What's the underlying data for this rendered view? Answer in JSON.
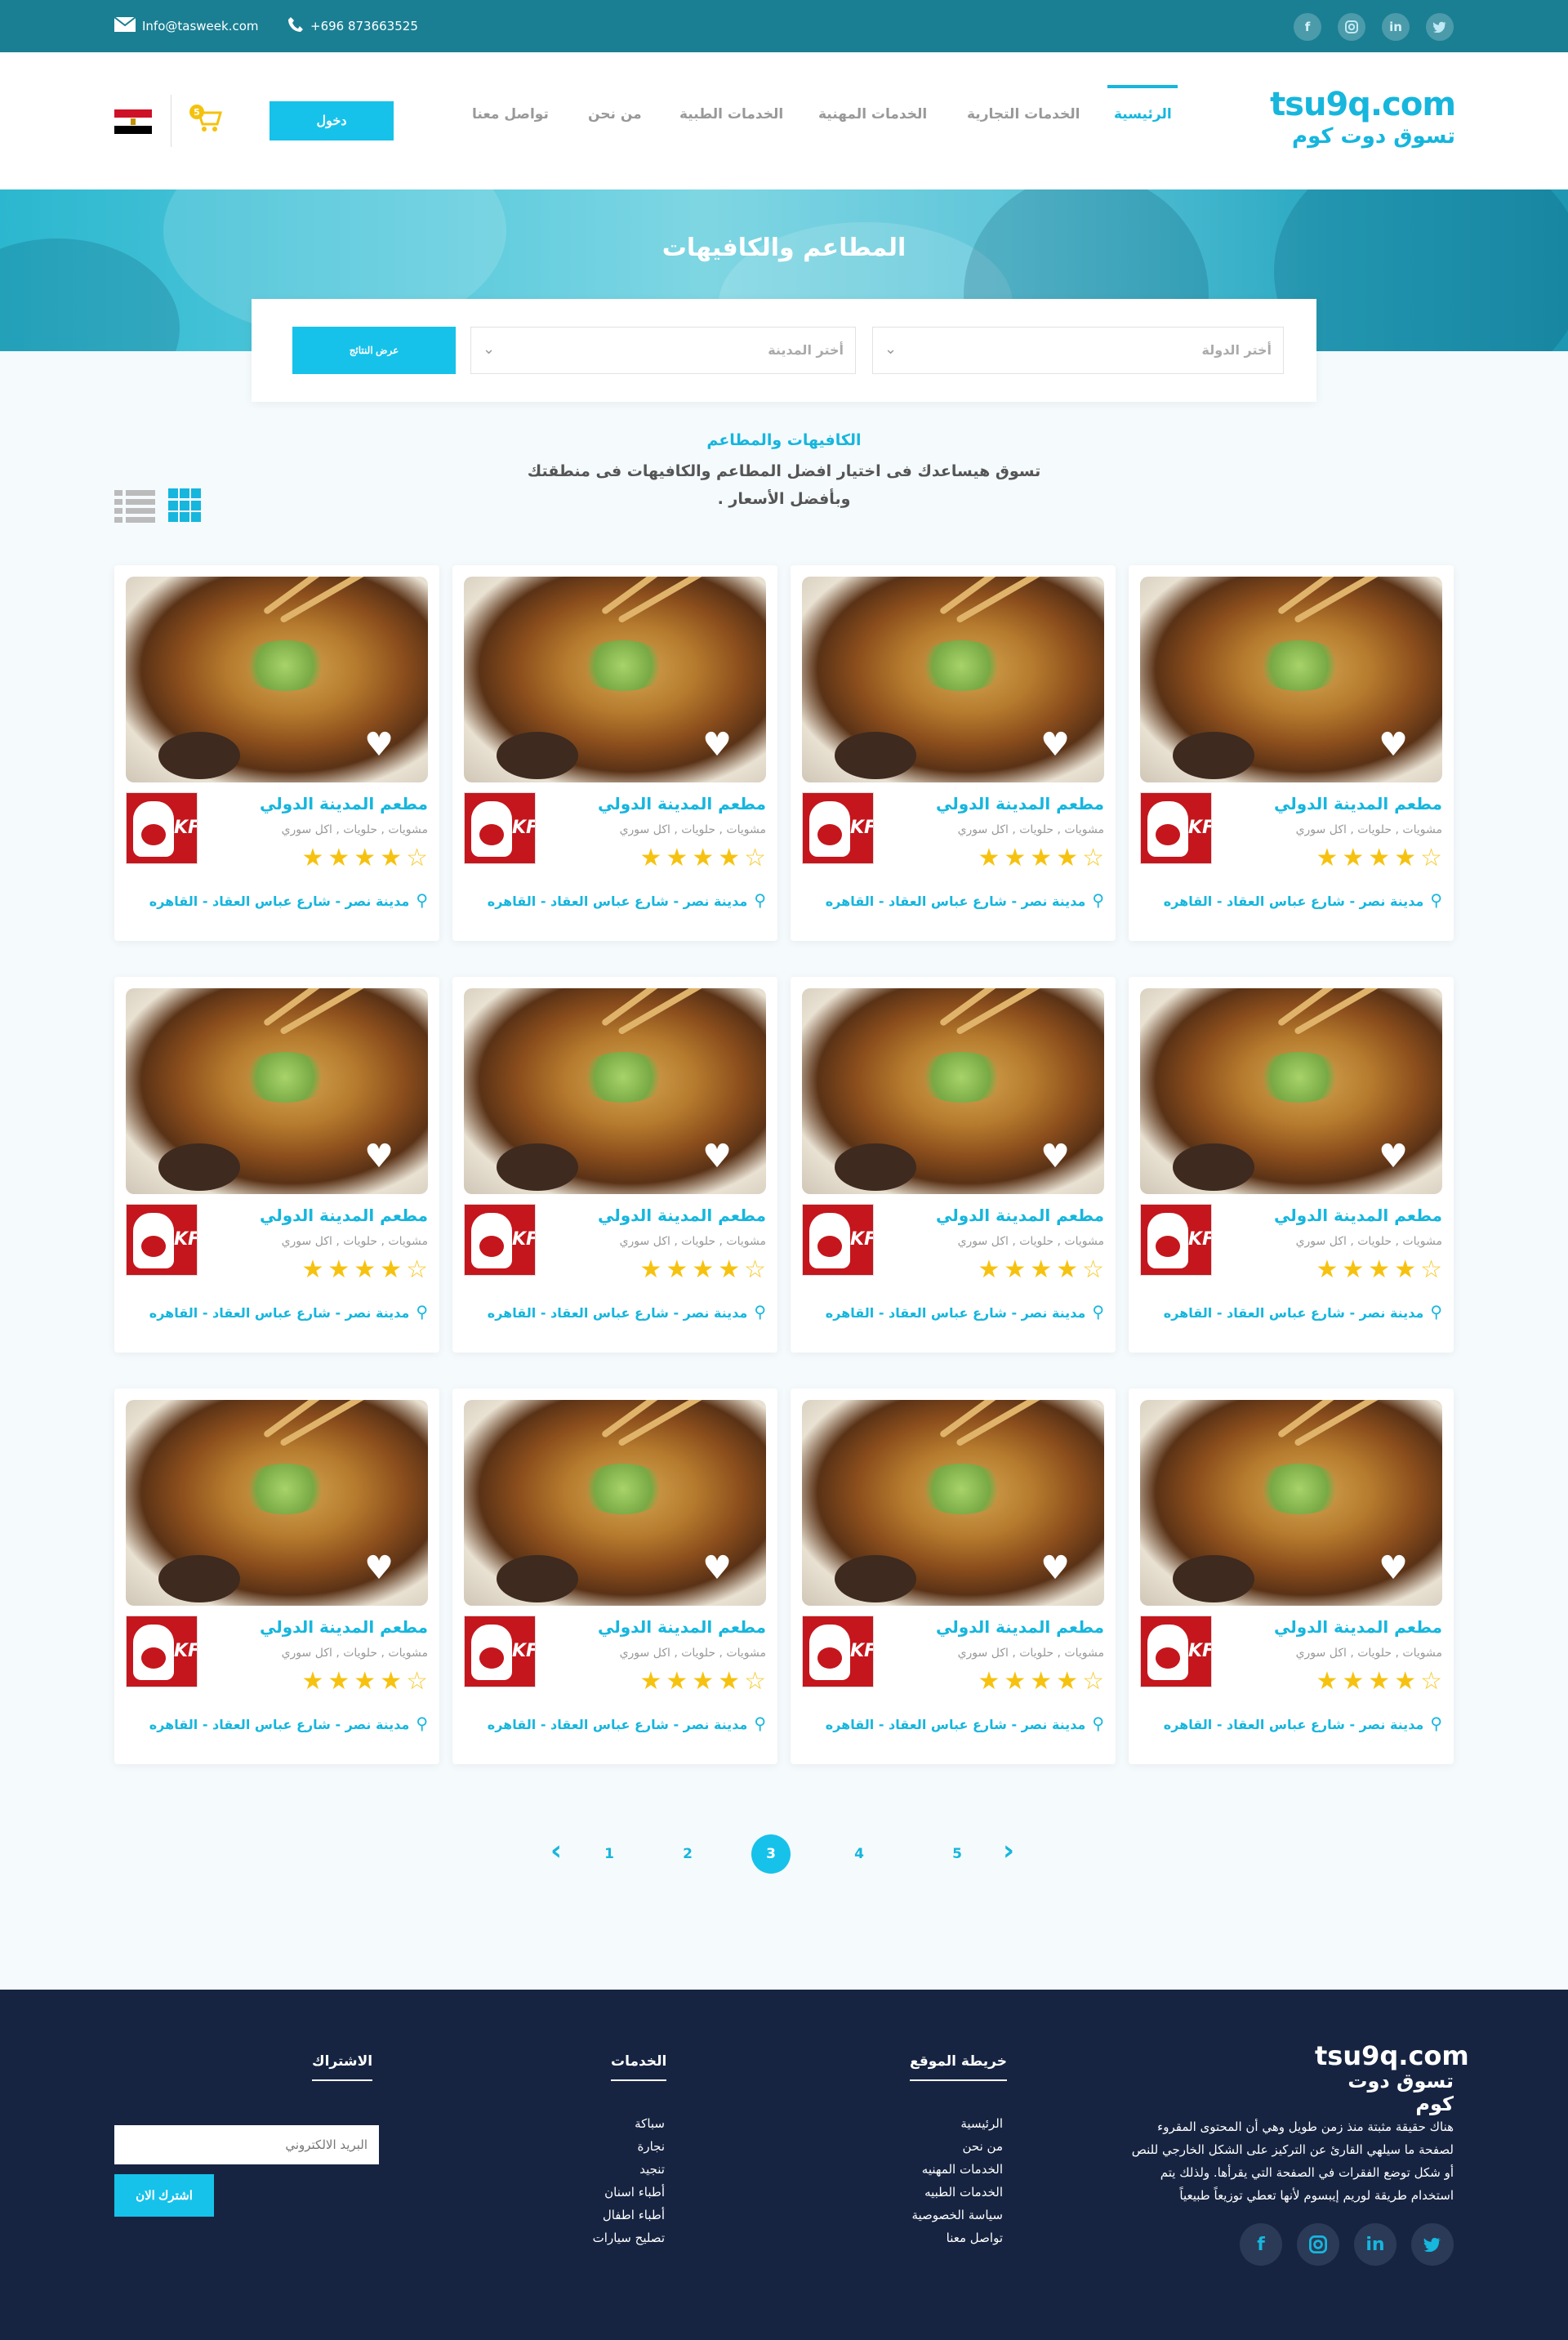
{
  "topbar": {
    "email": "Info@tasweek.com",
    "phone": "+696 873663525",
    "social": [
      "twitter-icon",
      "linkedin-icon",
      "instagram-icon",
      "facebook-icon"
    ]
  },
  "header": {
    "logo_en": "tsu9q.com",
    "logo_ar": "تسوق دوت كوم",
    "nav": [
      "الرئيسية",
      "الخدمات التجارية",
      "الخدمات المهنية",
      "الخدمات الطبية",
      "من نحن",
      "تواصل معنا"
    ],
    "login_label": "دخول",
    "cart_count": "5"
  },
  "hero": {
    "title": "المطاعم والكافيهات"
  },
  "search": {
    "country_placeholder": "أختر الدولة",
    "city_placeholder": "أختر المدينة",
    "results_label": "عرض النتائج"
  },
  "intro": {
    "title": "الكافيهات والمطاعم",
    "line1": "تسوق هيساعدك فى اختيار افضل المطاعم والكافيهات فى منطقتك",
    "line2": "وبأفضل الأسعار ."
  },
  "cards": [
    {
      "name": "مطعم المدينة الدولي",
      "tags": "مشويات , حلويات , اكل سوري",
      "rating": 4,
      "address": "مدينة نصر - شارع عباس العقاد - القاهره"
    },
    {
      "name": "مطعم المدينة الدولي",
      "tags": "مشويات , حلويات , اكل سوري",
      "rating": 4,
      "address": "مدينة نصر - شارع عباس العقاد - القاهره"
    },
    {
      "name": "مطعم المدينة الدولي",
      "tags": "مشويات , حلويات , اكل سوري",
      "rating": 4,
      "address": "مدينة نصر - شارع عباس العقاد - القاهره"
    },
    {
      "name": "مطعم المدينة الدولي",
      "tags": "مشويات , حلويات , اكل سوري",
      "rating": 4,
      "address": "مدينة نصر - شارع عباس العقاد - القاهره"
    },
    {
      "name": "مطعم المدينة الدولي",
      "tags": "مشويات , حلويات , اكل سوري",
      "rating": 4,
      "address": "مدينة نصر - شارع عباس العقاد - القاهره"
    },
    {
      "name": "مطعم المدينة الدولي",
      "tags": "مشويات , حلويات , اكل سوري",
      "rating": 4,
      "address": "مدينة نصر - شارع عباس العقاد - القاهره"
    },
    {
      "name": "مطعم المدينة الدولي",
      "tags": "مشويات , حلويات , اكل سوري",
      "rating": 4,
      "address": "مدينة نصر - شارع عباس العقاد - القاهره"
    },
    {
      "name": "مطعم المدينة الدولي",
      "tags": "مشويات , حلويات , اكل سوري",
      "rating": 4,
      "address": "مدينة نصر - شارع عباس العقاد - القاهره"
    },
    {
      "name": "مطعم المدينة الدولي",
      "tags": "مشويات , حلويات , اكل سوري",
      "rating": 4,
      "address": "مدينة نصر - شارع عباس العقاد - القاهره"
    },
    {
      "name": "مطعم المدينة الدولي",
      "tags": "مشويات , حلويات , اكل سوري",
      "rating": 4,
      "address": "مدينة نصر - شارع عباس العقاد - القاهره"
    },
    {
      "name": "مطعم المدينة الدولي",
      "tags": "مشويات , حلويات , اكل سوري",
      "rating": 4,
      "address": "مدينة نصر - شارع عباس العقاد - القاهره"
    },
    {
      "name": "مطعم المدينة الدولي",
      "tags": "مشويات , حلويات , اكل سوري",
      "rating": 4,
      "address": "مدينة نصر - شارع عباس العقاد - القاهره"
    }
  ],
  "pagination": {
    "pages": [
      "1",
      "2",
      "3",
      "4",
      "5"
    ],
    "current": "3"
  },
  "footer": {
    "logo_en": "tsu9q.com",
    "logo_ar": "تسوق دوت كوم",
    "about": "هناك حقيقة مثبتة منذ زمن طويل وهي أن المحتوى المقروء لصفحة ما سيلهي القارئ عن التركيز على الشكل الخارجي للنص أو شكل توضع الفقرات في الصفحة التي يقرأها. ولذلك يتم استخدام طريقة لوريم إيبسوم لأنها تعطي توزيعاً طبيعياً",
    "sitemap_title": "خريطة الموقع",
    "sitemap": [
      "الرئيسية",
      "من نحن",
      "الخدمات المهنيه",
      "الخدمات الطبيه",
      "سياسة الخصوصية",
      "تواصل معنا"
    ],
    "services_title": "الخدمات",
    "services": [
      "سباكة",
      "نجارة",
      "تنجيد",
      "أطباء اسنان",
      "أطباء اطفال",
      "تصليح سيارات"
    ],
    "subscribe_title": "الاشتراك",
    "email_placeholder": "البريد الالكتروني",
    "subscribe_label": "اشترك الان"
  },
  "colors": {
    "accent": "#16b6dd",
    "topbar": "#1a7f93",
    "footer": "#162441",
    "star": "#f6c20f"
  }
}
